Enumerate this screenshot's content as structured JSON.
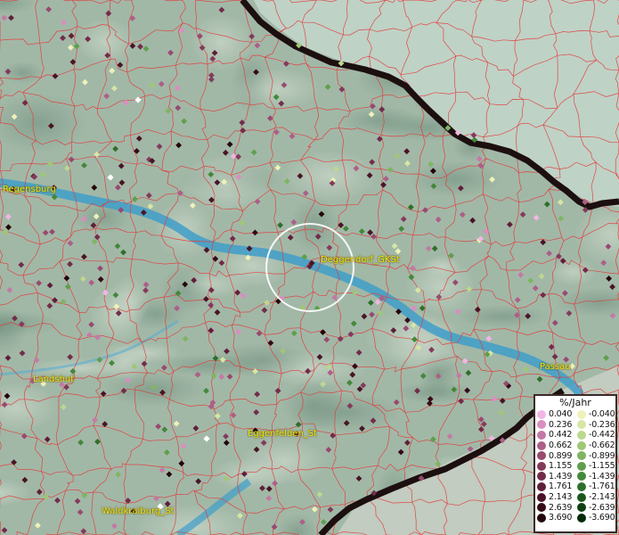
{
  "map": {
    "cities": [
      {
        "id": "regensburg",
        "name": "Regensburg"
      },
      {
        "id": "deggendorf",
        "name": "Deggendorf_GKSt"
      },
      {
        "id": "landshut",
        "name": "Landshut"
      },
      {
        "id": "passau",
        "name": "Passau"
      },
      {
        "id": "eggenfelden",
        "name": "Eggenfelden_St"
      },
      {
        "id": "waldkraiburg",
        "name": "Waldkraiburg_St"
      }
    ],
    "colors": {
      "district_border": "#e23a3a",
      "country_border": "#1c0f0f",
      "river": "#3f9ec9",
      "city_label": "#f4e61a",
      "highlight_circle": "#ffffff"
    }
  },
  "legend": {
    "unit": "%/Jahr",
    "positive": [
      {
        "value": "0.040",
        "color": "#f2b6e4"
      },
      {
        "value": "0.236",
        "color": "#d98ec0"
      },
      {
        "value": "0.442",
        "color": "#c27aa5"
      },
      {
        "value": "0.662",
        "color": "#ad5f88"
      },
      {
        "value": "0.899",
        "color": "#984a70"
      },
      {
        "value": "1.155",
        "color": "#843a5c"
      },
      {
        "value": "1.439",
        "color": "#722c4a"
      },
      {
        "value": "1.761",
        "color": "#5f1f38"
      },
      {
        "value": "2.143",
        "color": "#4a1426"
      },
      {
        "value": "2.639",
        "color": "#360a18"
      },
      {
        "value": "3.690",
        "color": "#22040a"
      }
    ],
    "negative": [
      {
        "value": "-0.040",
        "color": "#eef2b8"
      },
      {
        "value": "-0.236",
        "color": "#d6e6a4"
      },
      {
        "value": "-0.442",
        "color": "#bcd88e"
      },
      {
        "value": "-0.662",
        "color": "#9fc776"
      },
      {
        "value": "-0.899",
        "color": "#7fb562"
      },
      {
        "value": "-1.155",
        "color": "#5f9f4c"
      },
      {
        "value": "-1.439",
        "color": "#43883a"
      },
      {
        "value": "-1.761",
        "color": "#2d702a"
      },
      {
        "value": "-2.143",
        "color": "#1c581d"
      },
      {
        "value": "-2.639",
        "color": "#0f4112"
      },
      {
        "value": "-3.690",
        "color": "#052a08"
      }
    ]
  }
}
